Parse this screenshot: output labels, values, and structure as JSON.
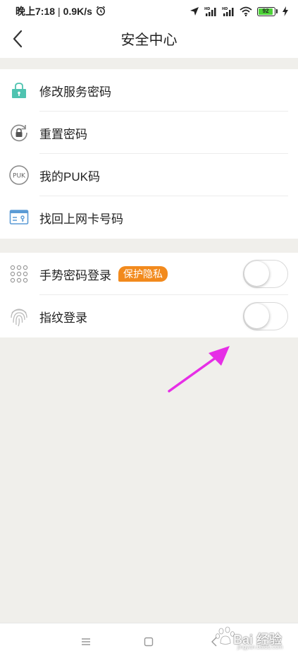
{
  "status_bar": {
    "time": "晚上7:18",
    "separator": "|",
    "speed": "0.9K/s",
    "battery_level": "92",
    "icons": [
      "alarm-icon",
      "location-icon",
      "signal-hd-icon",
      "signal-hd-icon",
      "wifi-icon",
      "battery-icon",
      "charging-icon"
    ]
  },
  "header": {
    "title": "安全中心",
    "back_icon": "chevron-left-icon"
  },
  "group1": [
    {
      "label": "修改服务密码",
      "icon": "lock-icon"
    },
    {
      "label": "重置密码",
      "icon": "reset-lock-icon"
    },
    {
      "label": "我的PUK码",
      "icon": "puk-icon",
      "icon_text": "PUK"
    },
    {
      "label": "找回上网卡号码",
      "icon": "sim-card-icon"
    }
  ],
  "group2": [
    {
      "label": "手势密码登录",
      "icon": "gesture-dots-icon",
      "badge": "保护隐私",
      "toggle_on": false
    },
    {
      "label": "指纹登录",
      "icon": "fingerprint-icon",
      "toggle_on": false
    }
  ],
  "colors": {
    "accent_teal": "#4fc3b0",
    "badge_orange": "#f28a1d",
    "arrow_magenta": "#e62ee6",
    "page_bg": "#f0efeb"
  },
  "nav_bar": {
    "icons": [
      "menu-icon",
      "home-square-icon",
      "back-triangle-icon"
    ]
  },
  "watermark": {
    "text": "Bai 经验",
    "sub": "jingyan.baidu.com"
  }
}
